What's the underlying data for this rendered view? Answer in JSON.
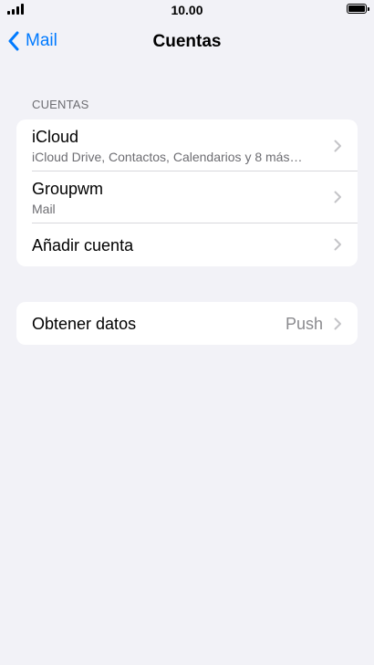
{
  "status_bar": {
    "time": "10.00"
  },
  "nav": {
    "back_label": "Mail",
    "title": "Cuentas"
  },
  "accounts_section": {
    "header": "CUENTAS",
    "items": [
      {
        "title": "iCloud",
        "subtitle": "iCloud Drive, Contactos, Calendarios y 8 más…"
      },
      {
        "title": "Groupwm",
        "subtitle": "Mail"
      },
      {
        "title": "Añadir cuenta"
      }
    ]
  },
  "fetch_section": {
    "title": "Obtener datos",
    "value": "Push"
  },
  "colors": {
    "background": "#f2f2f7",
    "accent": "#007aff",
    "secondary_text": "#6d6d72"
  }
}
